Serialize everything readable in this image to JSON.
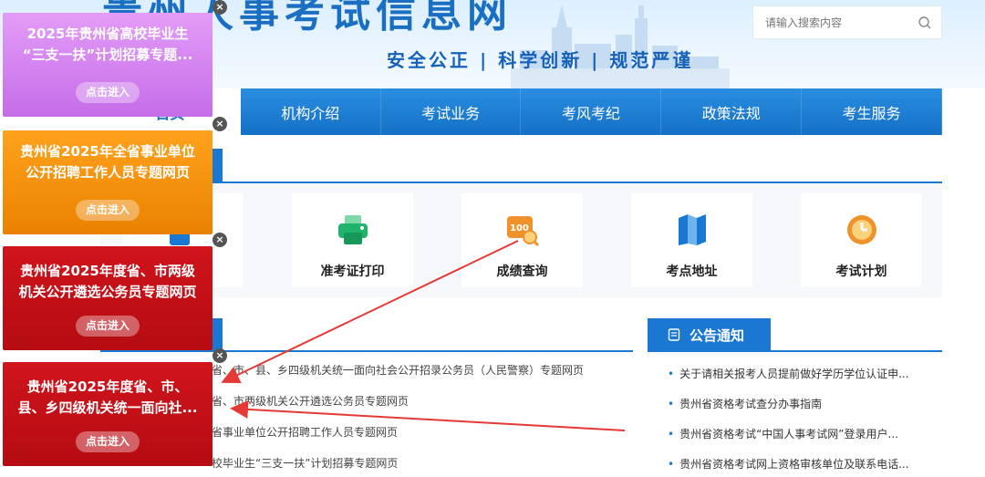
{
  "header": {
    "site_title": "贵州人事考试信息网",
    "slogan": "安全公正 | 科学创新 | 规范严谨",
    "search_placeholder": "请输入搜索内容"
  },
  "nav": {
    "items": [
      {
        "label": "首页",
        "active": true
      },
      {
        "label": "机构介绍"
      },
      {
        "label": "考试业务"
      },
      {
        "label": "考风考纪"
      },
      {
        "label": "政策法规"
      },
      {
        "label": "考生服务"
      }
    ]
  },
  "services": [
    {
      "label": "准考证打印",
      "icon": "printer-icon",
      "color": "#1fb36b"
    },
    {
      "label": "成绩查询",
      "icon": "score-100-icon",
      "color": "#f0922b"
    },
    {
      "label": "考点地址",
      "icon": "map-icon",
      "color": "#1a78d2"
    },
    {
      "label": "考试计划",
      "icon": "clock-icon",
      "color": "#f0922b"
    }
  ],
  "news": {
    "items": [
      "省、市、县、乡四级机关统一面向社会公开招录公务员（人民警察）专题网页",
      "省、市两级机关公开遴选公务员专题网页",
      "省事业单位公开招聘工作人员专题网页",
      "校毕业生“三支一扶”计划招募专题网页"
    ]
  },
  "notice": {
    "title": "公告通知",
    "items": [
      "关于请相关报考人员提前做好学历学位认证申...",
      "贵州省资格考试查分办事指南",
      "贵州省资格考试“中国人事考试网”登录用户...",
      "贵州省资格考试网上资格审核单位及联系电话..."
    ]
  },
  "banners": [
    {
      "line1": "2025年贵州省高校毕业生",
      "line2": "“三支一扶”计划招募专题...",
      "button": "点击进入",
      "color": "#d07af0"
    },
    {
      "line1": "贵州省2025年全省事业单位",
      "line2": "公开招聘工作人员专题网页",
      "button": "点击进入",
      "color": "#f59210"
    },
    {
      "line1": "贵州省2025年度省、市两级",
      "line2": "机关公开遴选公务员专题网页",
      "button": "点击进入",
      "color": "#c8101a"
    },
    {
      "line1": "贵州省2025年度省、市、",
      "line2": "县、乡四级机关统一面向社...",
      "button": "点击进入",
      "color": "#c8101a"
    }
  ],
  "annotation_color": "#e53935"
}
